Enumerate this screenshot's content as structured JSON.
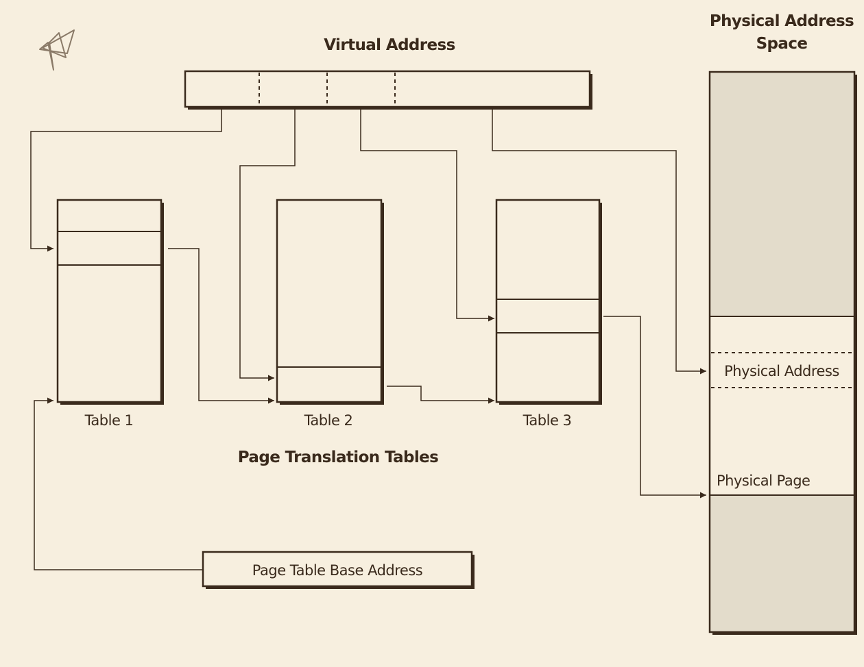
{
  "labels": {
    "virtual_address": "Virtual Address",
    "physical_address_space_line1": "Physical Address",
    "physical_address_space_line2": "Space",
    "table1": "Table 1",
    "table2": "Table 2",
    "table3": "Table 3",
    "page_translation_tables": "Page Translation Tables",
    "page_table_base_address": "Page Table Base Address",
    "physical_address": "Physical Address",
    "physical_page": "Physical Page"
  },
  "icons": {
    "logo": "star-icon"
  },
  "colors": {
    "background": "#f7efdf",
    "ink": "#3a2a1c",
    "shaded_region": "#e3dccb"
  }
}
